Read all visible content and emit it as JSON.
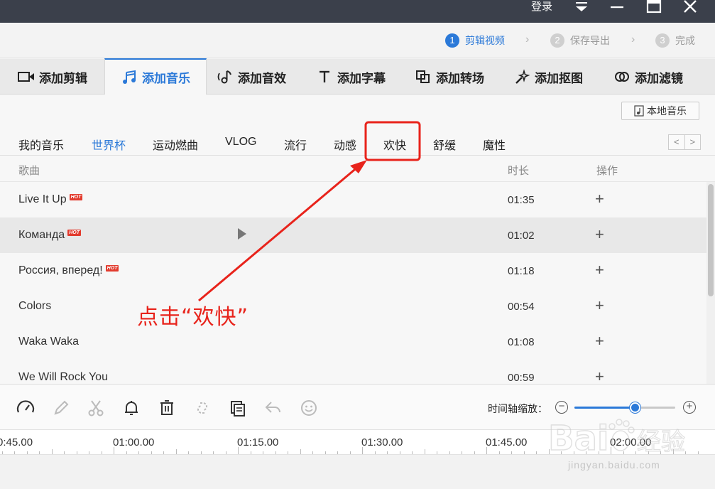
{
  "titlebar": {
    "login": "登录",
    "icons": [
      "dropdown-icon",
      "minimize-icon",
      "maximize-icon",
      "close-icon"
    ]
  },
  "steps": [
    {
      "num": "1",
      "label": "剪辑视频",
      "active": true
    },
    {
      "num": "2",
      "label": "保存导出",
      "active": false
    },
    {
      "num": "3",
      "label": "完成",
      "active": false
    }
  ],
  "tooltabs": [
    {
      "label": "添加剪辑",
      "icon": "video-camera-icon"
    },
    {
      "label": "添加音乐",
      "icon": "music-note-icon",
      "active": true
    },
    {
      "label": "添加音效",
      "icon": "sound-effect-icon"
    },
    {
      "label": "添加字幕",
      "icon": "text-icon"
    },
    {
      "label": "添加转场",
      "icon": "transition-icon"
    },
    {
      "label": "添加抠图",
      "icon": "cutout-icon"
    },
    {
      "label": "添加滤镜",
      "icon": "filter-icon"
    }
  ],
  "local_music": "本地音乐",
  "categories": [
    "我的音乐",
    "世界杯",
    "运动燃曲",
    "VLOG",
    "流行",
    "动感",
    "欢快",
    "舒缓",
    "魔性"
  ],
  "category_arrows": {
    "prev": "<",
    "next": ">"
  },
  "table": {
    "col_song": "歌曲",
    "col_duration": "时长",
    "col_action": "操作",
    "rows": [
      {
        "name": "Live It Up",
        "hot": "HOT",
        "duration": "01:35",
        "add": "+"
      },
      {
        "name": "Команда",
        "hot": "HOT",
        "duration": "01:02",
        "add": "+"
      },
      {
        "name": "Россия, вперед!",
        "hot": "HOT",
        "duration": "01:18",
        "add": "+"
      },
      {
        "name": "Colors",
        "hot": "",
        "duration": "00:54",
        "add": "+"
      },
      {
        "name": "Waka Waka",
        "hot": "",
        "duration": "01:08",
        "add": "+"
      },
      {
        "name": "We Will Rock You",
        "hot": "",
        "duration": "00:59",
        "add": "+"
      }
    ]
  },
  "toolbar": {
    "zoom_label": "时间轴缩放：",
    "zoom_minus": "−",
    "zoom_plus": "+",
    "zoom_level": 0.6
  },
  "ruler": [
    "0:45.00",
    "01:00.00",
    "01:15.00",
    "01:30.00",
    "01:45.00",
    "02:00.00"
  ],
  "annotation": "点击“欢快”",
  "watermark": "jingyan.baidu.com",
  "colors": {
    "accent": "#2b79d8",
    "annotation": "#e8231b",
    "titlebar": "#3b404b"
  }
}
